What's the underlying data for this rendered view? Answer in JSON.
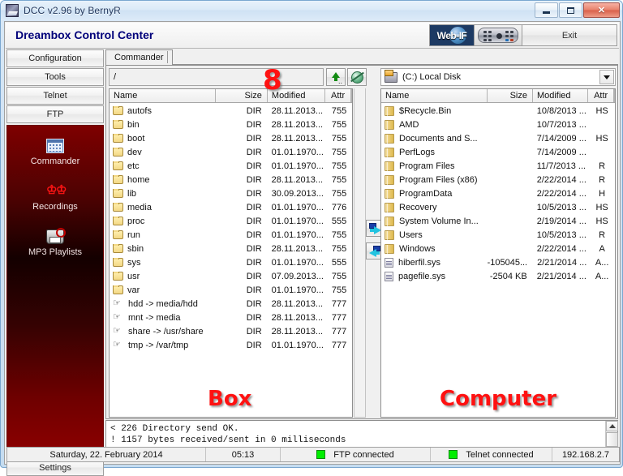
{
  "window": {
    "title": "DCC v2.96 by BernyR",
    "app_icon": "dcc-app-icon",
    "controls": {
      "minimize": "minimize",
      "maximize": "maximize",
      "close": "close"
    }
  },
  "header": {
    "title": "Dreambox Control Center",
    "webif_label": "Web-IF",
    "remote_label": "",
    "exit_label": "Exit"
  },
  "sidebar": {
    "tabs": [
      {
        "label": "Configuration"
      },
      {
        "label": "Tools"
      },
      {
        "label": "Telnet"
      },
      {
        "label": "FTP"
      }
    ],
    "items": [
      {
        "label": "Commander",
        "icon": "commander-grid-icon"
      },
      {
        "label": "Recordings",
        "icon": "running-men-icon"
      },
      {
        "label": "MP3 Playlists",
        "icon": "mp3-player-icon"
      }
    ],
    "settings_label": "Settings"
  },
  "tabs": [
    {
      "label": "Commander"
    }
  ],
  "left_pane": {
    "path": "/",
    "up_button": "parent-folder",
    "refresh_button": "refresh-globe",
    "columns": [
      "Name",
      "Size",
      "Modified",
      "Attr"
    ],
    "rows": [
      {
        "icon": "folder",
        "name": "autofs",
        "size": "DIR",
        "modified": "28.11.2013...",
        "attr": "755"
      },
      {
        "icon": "folder",
        "name": "bin",
        "size": "DIR",
        "modified": "28.11.2013...",
        "attr": "755"
      },
      {
        "icon": "folder",
        "name": "boot",
        "size": "DIR",
        "modified": "28.11.2013...",
        "attr": "755"
      },
      {
        "icon": "folder",
        "name": "dev",
        "size": "DIR",
        "modified": "01.01.1970...",
        "attr": "755"
      },
      {
        "icon": "folder",
        "name": "etc",
        "size": "DIR",
        "modified": "01.01.1970...",
        "attr": "755"
      },
      {
        "icon": "folder",
        "name": "home",
        "size": "DIR",
        "modified": "28.11.2013...",
        "attr": "755"
      },
      {
        "icon": "folder",
        "name": "lib",
        "size": "DIR",
        "modified": "30.09.2013...",
        "attr": "755"
      },
      {
        "icon": "folder",
        "name": "media",
        "size": "DIR",
        "modified": "01.01.1970...",
        "attr": "776"
      },
      {
        "icon": "folder",
        "name": "proc",
        "size": "DIR",
        "modified": "01.01.1970...",
        "attr": "555"
      },
      {
        "icon": "folder",
        "name": "run",
        "size": "DIR",
        "modified": "01.01.1970...",
        "attr": "755"
      },
      {
        "icon": "folder",
        "name": "sbin",
        "size": "DIR",
        "modified": "28.11.2013...",
        "attr": "755"
      },
      {
        "icon": "folder",
        "name": "sys",
        "size": "DIR",
        "modified": "01.01.1970...",
        "attr": "555"
      },
      {
        "icon": "folder",
        "name": "usr",
        "size": "DIR",
        "modified": "07.09.2013...",
        "attr": "755"
      },
      {
        "icon": "folder",
        "name": "var",
        "size": "DIR",
        "modified": "01.01.1970...",
        "attr": "755"
      },
      {
        "icon": "link",
        "name": "hdd -> media/hdd",
        "size": "DIR",
        "modified": "28.11.2013...",
        "attr": "777"
      },
      {
        "icon": "link",
        "name": "mnt -> media",
        "size": "DIR",
        "modified": "28.11.2013...",
        "attr": "777"
      },
      {
        "icon": "link",
        "name": "share -> /usr/share",
        "size": "DIR",
        "modified": "28.11.2013...",
        "attr": "777"
      },
      {
        "icon": "link",
        "name": "tmp -> /var/tmp",
        "size": "DIR",
        "modified": "01.01.1970...",
        "attr": "777"
      }
    ]
  },
  "right_pane": {
    "drive": "(C:)  Local Disk",
    "drive_icon": "local-disk-icon",
    "columns": [
      "Name",
      "Size",
      "Modified",
      "Attr"
    ],
    "rows": [
      {
        "icon": "folder",
        "name": "$Recycle.Bin",
        "size": "",
        "modified": "10/8/2013 ...",
        "attr": "HS"
      },
      {
        "icon": "folder",
        "name": "AMD",
        "size": "",
        "modified": "10/7/2013 ...",
        "attr": ""
      },
      {
        "icon": "folder",
        "name": "Documents and S...",
        "size": "",
        "modified": "7/14/2009 ...",
        "attr": "HS"
      },
      {
        "icon": "folder",
        "name": "PerfLogs",
        "size": "",
        "modified": "7/14/2009 ...",
        "attr": ""
      },
      {
        "icon": "folder",
        "name": "Program Files",
        "size": "",
        "modified": "11/7/2013 ...",
        "attr": "R"
      },
      {
        "icon": "folder",
        "name": "Program Files (x86)",
        "size": "",
        "modified": "2/22/2014 ...",
        "attr": "R"
      },
      {
        "icon": "folder",
        "name": "ProgramData",
        "size": "",
        "modified": "2/22/2014 ...",
        "attr": "H"
      },
      {
        "icon": "folder",
        "name": "Recovery",
        "size": "",
        "modified": "10/5/2013 ...",
        "attr": "HS"
      },
      {
        "icon": "folder",
        "name": "System Volume In...",
        "size": "",
        "modified": "2/19/2014 ...",
        "attr": "HS"
      },
      {
        "icon": "folder",
        "name": "Users",
        "size": "",
        "modified": "10/5/2013 ...",
        "attr": "R"
      },
      {
        "icon": "folder",
        "name": "Windows",
        "size": "",
        "modified": "2/22/2014 ...",
        "attr": "A"
      },
      {
        "icon": "file",
        "name": "hiberfil.sys",
        "size": "-105045...",
        "modified": "2/21/2014 ...",
        "attr": "A..."
      },
      {
        "icon": "file",
        "name": "pagefile.sys",
        "size": "-2504 KB",
        "modified": "2/21/2014 ...",
        "attr": "A..."
      }
    ]
  },
  "transfer": {
    "to_right": "copy-to-computer",
    "to_left": "copy-to-box"
  },
  "annotations": [
    {
      "id": "eight",
      "text": "8",
      "color": "#ff1111"
    },
    {
      "id": "box",
      "text": "Box",
      "color": "#ff1111"
    },
    {
      "id": "computer",
      "text": "Computer",
      "color": "#ff1111"
    }
  ],
  "log": {
    "lines": [
      "< 226 Directory send OK.",
      "! 1157 bytes received/sent in 0 milliseconds"
    ]
  },
  "statusbar": {
    "date": "Saturday, 22. February 2014",
    "time": "05:13",
    "ftp_status": "FTP connected",
    "telnet_status": "Telnet connected",
    "ip": "192.168.2.7",
    "led_color": "#00ee00"
  }
}
